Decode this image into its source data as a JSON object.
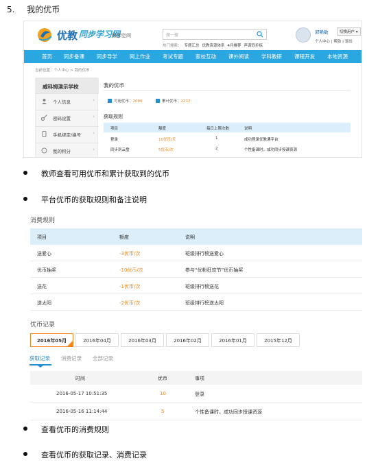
{
  "heading": {
    "number": "5.",
    "title": "我的优币"
  },
  "screenshot": {
    "logo_main": "优教",
    "logo_sub": "同步学习网",
    "logo_space": "教师空间",
    "search_placeholder": "搜一搜",
    "hot_label": "热门搜索：",
    "hot_items": [
      "专题汇总",
      "优教资源体系",
      "4月推荐",
      "声调同步练"
    ],
    "user_name": "郭艳敏",
    "switch_label": "切换用户",
    "user_links": "个人中心 | 帮助 | 退出",
    "nav": [
      "首页",
      "同步备课",
      "同步导学",
      "网上作业",
      "考试专题",
      "家校互动",
      "课外阅读",
      "学科教研",
      "课程开发",
      "本地资源"
    ],
    "breadcrumb": "当前位置：个人中心 > 我的优币",
    "sidebar": {
      "school": "威科姆演示学校",
      "items": [
        {
          "label": "个人信息",
          "icon": "user-icon"
        },
        {
          "label": "密码设置",
          "icon": "key-icon"
        },
        {
          "label": "手机绑定/换号",
          "icon": "phone-icon"
        },
        {
          "label": "我的积分",
          "icon": "coin-icon"
        }
      ]
    },
    "main_title": "我的优币",
    "stats": {
      "available_label": "可用优币：",
      "available_value": "2086",
      "total_label": "累计优币：",
      "total_value": "2232"
    },
    "rules_title": "获取规则",
    "rules_headers": [
      "项目",
      "额度",
      "每日上限次数",
      "说明"
    ],
    "rules_rows": [
      [
        "登录",
        "10优币/天",
        "1",
        "成功登录优教通平台"
      ],
      [
        "同步到云盘",
        "5优币/次",
        "2",
        "个性备课时，成功同步授课资源"
      ]
    ]
  },
  "bullets": [
    "教师查看可用优币和累计获取到的优币",
    "平台优币的获取规则和备注说明",
    "查看优币的消费规则",
    "查看优币的获取记录、消费记录"
  ],
  "consume": {
    "title": "消费规则",
    "headers": [
      "项目",
      "额度",
      "说明"
    ],
    "rows": [
      [
        "送爱心",
        "-3优币/次",
        "班级排行榜送爱心"
      ],
      [
        "优币抽奖",
        "-10优币/次",
        "参与“优粉狂欢节”优币抽奖"
      ],
      [
        "送花",
        "-1优币/次",
        "班级排行榜送花"
      ],
      [
        "送太阳",
        "-2优币/次",
        "班级排行榜送太阳"
      ]
    ]
  },
  "records": {
    "title": "优币记录",
    "months": [
      "2016年05月",
      "2016年04月",
      "2016年03月",
      "2016年02月",
      "2016年01月",
      "2015年12月"
    ],
    "tabs": [
      "获取记录",
      "消费记录",
      "全部记录"
    ],
    "headers": [
      "时间",
      "优币",
      "事项"
    ],
    "rows": [
      [
        "2016-05-17 10:51:35",
        "10",
        "登录"
      ],
      [
        "2016-05-16 11:14:44",
        "5",
        "个性备课时，成功同步授课资源"
      ]
    ]
  }
}
